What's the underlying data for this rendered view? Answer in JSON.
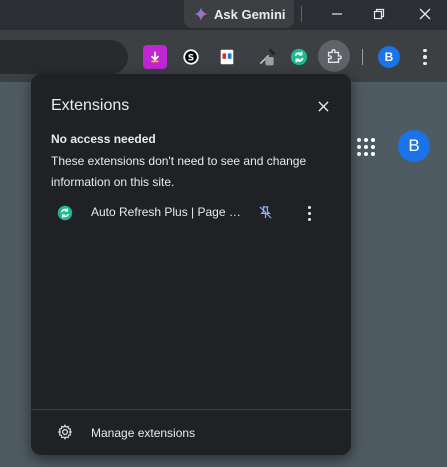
{
  "titlebar": {
    "ask_gemini_label": "Ask Gemini"
  },
  "toolbar": {
    "extension_icons": [
      "download-extension-icon",
      "s-extension-icon",
      "pdf-extension-icon",
      "eyedropper-extension-icon",
      "auto-refresh-extension-icon"
    ],
    "profile_initial": "B"
  },
  "page": {
    "profile_initial": "B"
  },
  "popup": {
    "title": "Extensions",
    "section_title": "No access needed",
    "section_description": "These extensions don't need to see and change information on this site.",
    "extensions": [
      {
        "name": "Auto Refresh Plus | Page M...",
        "icon": "auto-refresh-icon",
        "pinned": false
      }
    ],
    "manage_label": "Manage extensions"
  },
  "colors": {
    "accent": "#1a73e8",
    "popup_bg": "#202124",
    "extension_green": "#1db98f"
  }
}
